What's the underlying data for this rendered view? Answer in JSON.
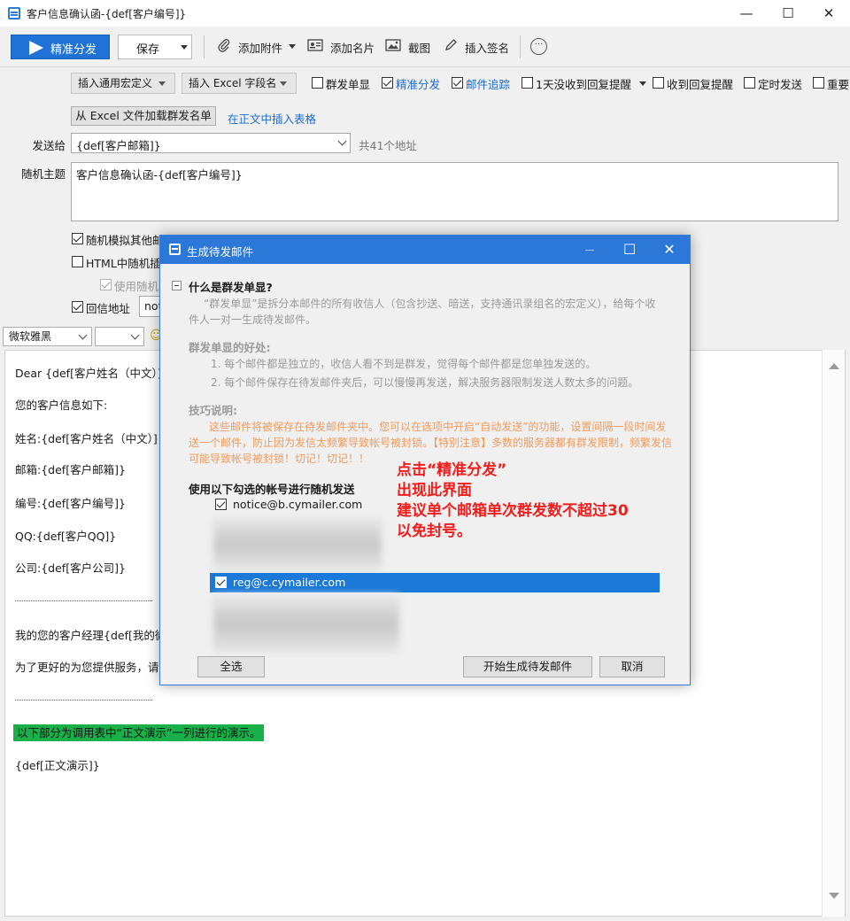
{
  "window": {
    "title": "客户信息确认函-{def[客户编号]}",
    "minimize": "—",
    "maximize": "☐",
    "close": "✕"
  },
  "toolbar": {
    "send_label": "精准分发",
    "save_label": "保存",
    "attach_label": "添加附件",
    "card_label": "添加名片",
    "screenshot_label": "截图",
    "signature_label": "插入签名",
    "more_label": "···"
  },
  "options": {
    "macro_label": "插入通用宏定义",
    "excel_field_label": "插入 Excel 字段名",
    "group_single": "群发单显",
    "precise": "精准分发",
    "tracking": "邮件追踪",
    "reminder_1day": "1天没收到回复提醒",
    "reply_reminder": "收到回复提醒",
    "scheduled": "定时发送",
    "important": "重要"
  },
  "form": {
    "load_excel_label": "从 Excel 文件加载群发名单",
    "insert_table_link": "在正文中插入表格",
    "to_label": "发送给",
    "to_value": "{def[客户邮箱]}",
    "to_count": "共41个地址",
    "subject_label": "随机主题",
    "subject_value": "客户信息确认函-{def[客户编号]}",
    "opt_random_sim": "随机模拟其他邮件客户端发送",
    "opt_html_random": "HTML中随机插",
    "opt_use_random": "使用随机",
    "opt_reply_addr": "回信地址",
    "reply_value": "noti"
  },
  "editor": {
    "font": "微软雅黑",
    "size": "",
    "emoji": "☺",
    "lines": [
      "Dear {def[客户姓名（中文）]}:",
      "您的客户信息如下:",
      "姓名:{def[客户姓名（中文）]",
      "邮箱:{def[客户邮箱]}",
      "编号:{def[客户编号]}",
      "QQ:{def[客户QQ]}",
      "公司:{def[客户公司]}",
      "我的您的客户经理{def[我的微信",
      "为了更好的为您提供服务，请添",
      "以下部分为调用表中“正文演示”一列进行的演示。",
      "{def[正文演示]}"
    ],
    "highlight_color": "#19b04a"
  },
  "dialog": {
    "title": "生成待发邮件",
    "maximize": "☐",
    "close": "✕",
    "section_title": "什么是群发单显?",
    "intro_l1": "“群发单显”是拆分本邮件的所有收信人（包含抄送、暗送，支持通讯录组名的宏定义），给每个收",
    "intro_l2": "件人一对一生成待发邮件。",
    "benefits_title": "群发单显的好处:",
    "benefit_1": "1. 每个邮件都是独立的，收信人看不到是群发，觉得每个邮件都是您单独发送的。",
    "benefit_2": "2. 每个邮件保存在待发邮件夹后，可以慢慢再发送，解决服务器限制发送人数太多的问题。",
    "tips_title": "技巧说明:",
    "tip_l1": "这些邮件将被保存在待发邮件夹中。您可以在选项中开启“自动发送”的功能，设置间隔一段时间发",
    "tip_l2": "送一个邮件，防止因为发信太频繁导致帐号被封锁。【特别注意】多数的服务器都有群发限制，频繁发信",
    "tip_l3": "可能导致帐号被封锁！切记！切记！！",
    "accounts_title": "使用以下勾选的帐号进行随机发送",
    "accounts": [
      {
        "email": "notice@b.cymailer.com",
        "checked": true,
        "selected": false
      },
      {
        "email": "reg@c.cymailer.com",
        "checked": true,
        "selected": true
      }
    ],
    "select_all": "全选",
    "start": "开始生成待发邮件",
    "cancel": "取消"
  },
  "annotation": {
    "line1": "点击“精准分发”",
    "line2": "出现此界面",
    "line3": "建议单个邮箱单次群发数不超过30",
    "line4": "以免封号。",
    "color": "#f01d1d"
  },
  "colors": {
    "accent": "#1f73d6",
    "dialog_title": "#2b78d8",
    "selected_row": "#1a78d8",
    "tip_orange": "#f19a5c"
  }
}
